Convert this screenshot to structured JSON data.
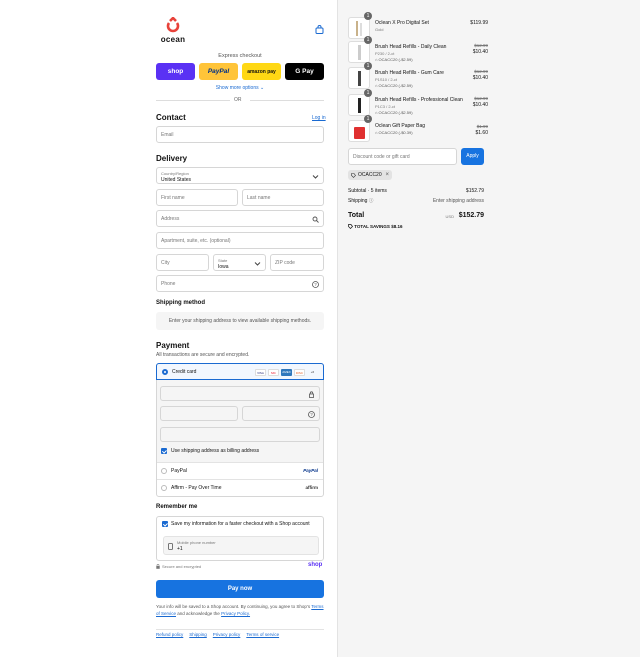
{
  "header": {
    "brand": "ocean"
  },
  "express": {
    "label": "Express checkout",
    "buttons": [
      "shop",
      "PayPal",
      "amazon pay",
      "G Pay"
    ],
    "show_more": "Show more options ⌄",
    "or": "OR"
  },
  "contact": {
    "title": "Contact",
    "login": "Log in",
    "email_placeholder": "Email"
  },
  "delivery": {
    "title": "Delivery",
    "country_label": "Country/Region",
    "country_value": "United States",
    "first_name": "First name",
    "last_name": "Last name",
    "address": "Address",
    "apartment": "Apartment, suite, etc. (optional)",
    "city": "City",
    "state_label": "State",
    "state_value": "Iowa",
    "zip": "ZIP code",
    "phone": "Phone"
  },
  "shipping": {
    "title": "Shipping method",
    "note": "Enter your shipping address to view available shipping methods."
  },
  "payment": {
    "title": "Payment",
    "subtitle": "All transactions are secure and encrypted.",
    "credit_card": "Credit card",
    "card_brands": [
      "VISA",
      "MC",
      "AMEX",
      "DISC",
      "+6"
    ],
    "billing_same": "Use shipping address as billing address",
    "paypal": "PayPal",
    "paypal_logo": "PayPal",
    "affirm": "Affirm - Pay Over Time",
    "affirm_logo": "affirm"
  },
  "remember": {
    "title": "Remember me",
    "save_label": "Save my information for a faster checkout with a Shop account",
    "mobile_label": "Mobile phone number",
    "mobile_value": "+1",
    "secure": "Secure and encrypted",
    "shop": "shop"
  },
  "pay_button": "Pay now",
  "legal": {
    "line1": "Your info will be saved to a Shop account. By continuing, you agree to Shop’s",
    "tos": "Terms of Service",
    "mid": "and acknowledge the",
    "privacy": "Privacy Policy."
  },
  "footer_links": [
    "Refund policy",
    "Shipping",
    "Privacy policy",
    "Terms of service"
  ],
  "summary": {
    "items": [
      {
        "qty": "1",
        "name": "Oclean X Pro Digital Set",
        "sub": "Gold",
        "price": "$119.99",
        "was": "",
        "code": ""
      },
      {
        "qty": "1",
        "name": "Brush Head Refills - Daily Clean",
        "sub": "P230 / 2-ct",
        "price": "$10.40",
        "was": "$12.99",
        "code": "OCACC20 (-$2.59)"
      },
      {
        "qty": "1",
        "name": "Brush Head Refills - Gum Care",
        "sub": "P1S10 / 2-ct",
        "price": "$10.40",
        "was": "$12.99",
        "code": "OCACC20 (-$2.59)"
      },
      {
        "qty": "1",
        "name": "Brush Head Refills - Professional Clean",
        "sub": "P1C3 / 2-ct",
        "price": "$10.40",
        "was": "$12.99",
        "code": "OCACC20 (-$2.59)"
      },
      {
        "qty": "1",
        "name": "Oclean Gift Paper Bag",
        "sub": "",
        "price": "$1.60",
        "was": "$1.99",
        "code": "OCACC20 (-$0.39)"
      }
    ],
    "discount_placeholder": "Discount code or gift card",
    "apply": "Apply",
    "chip": "OCACC20",
    "subtotal_label": "Subtotal · 5 items",
    "subtotal": "$152.79",
    "shipping_label": "Shipping",
    "shipping": "Enter shipping address",
    "total_label": "Total",
    "currency": "USD",
    "total": "$152.79",
    "savings_label": "TOTAL SAVINGS",
    "savings": "$8.16"
  },
  "colors": {
    "accent": "#1773e0",
    "shop": "#5a31f4",
    "paypal": "#ffc439",
    "brand_red": "#e8423a"
  }
}
